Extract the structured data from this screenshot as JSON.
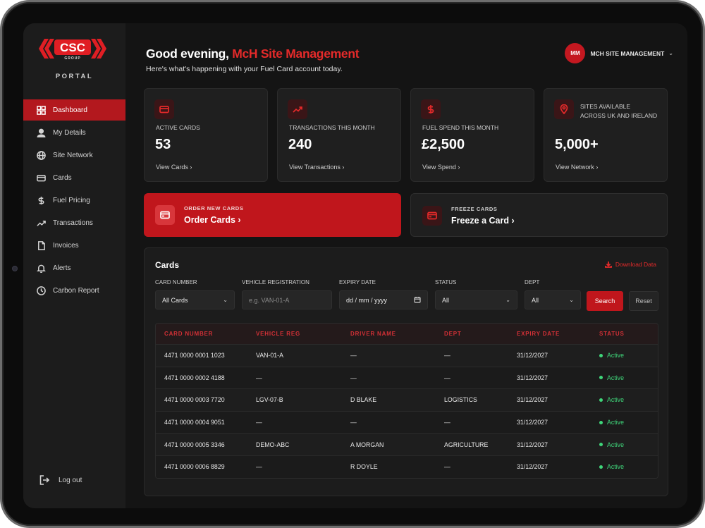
{
  "brand": {
    "logo_text": "CSC",
    "logo_sub": "GROUP",
    "portal": "PORTAL",
    "accent": "#c0161c"
  },
  "sidebar": {
    "items": [
      {
        "label": "Dashboard",
        "icon": "grid-icon",
        "active": true
      },
      {
        "label": "My Details",
        "icon": "user-icon"
      },
      {
        "label": "Site Network",
        "icon": "globe-icon"
      },
      {
        "label": "Cards",
        "icon": "card-icon"
      },
      {
        "label": "Fuel Pricing",
        "icon": "dollar-icon"
      },
      {
        "label": "Transactions",
        "icon": "trend-icon"
      },
      {
        "label": "Invoices",
        "icon": "document-icon"
      },
      {
        "label": "Alerts",
        "icon": "bell-icon"
      },
      {
        "label": "Carbon Report",
        "icon": "clock-icon"
      }
    ],
    "logout": "Log out"
  },
  "header": {
    "greeting_prefix": "Good evening, ",
    "greeting_name": "McH Site Management",
    "subtitle": "Here's what's happening with your Fuel Card account today.",
    "user_initials": "MM",
    "user_name": "MCH SITE MANAGEMENT"
  },
  "stats": [
    {
      "label": "ACTIVE CARDS",
      "value": "53",
      "link": "View Cards ›"
    },
    {
      "label": "TRANSACTIONS THIS MONTH",
      "value": "240",
      "link": "View Transactions ›"
    },
    {
      "label": "FUEL SPEND THIS MONTH",
      "value": "£2,500",
      "link": "View Spend ›"
    },
    {
      "label_line1": "SITES AVAILABLE",
      "label_line2": "ACROSS UK AND IRELAND",
      "value": "5,000+",
      "link": "View Network ›"
    }
  ],
  "actions": {
    "order": {
      "label": "ORDER NEW CARDS",
      "title": "Order Cards ›"
    },
    "freeze": {
      "label": "FREEZE CARDS",
      "title": "Freeze a Card ›"
    }
  },
  "cards_panel": {
    "title": "Cards",
    "download": "Download Data",
    "filters": {
      "card_number": {
        "label": "CARD NUMBER",
        "value": "All Cards"
      },
      "vehicle_reg": {
        "label": "VEHICLE REGISTRATION",
        "placeholder": "e.g. VAN-01-A"
      },
      "expiry": {
        "label": "EXPIRY DATE",
        "placeholder": "dd / mm / yyyy"
      },
      "status": {
        "label": "STATUS",
        "value": "All"
      },
      "dept": {
        "label": "DEPT",
        "value": "All"
      },
      "search": "Search",
      "reset": "Reset"
    },
    "columns": [
      "CARD NUMBER",
      "VEHICLE REG",
      "DRIVER NAME",
      "DEPT",
      "EXPIRY DATE",
      "STATUS"
    ],
    "rows": [
      [
        "4471 0000 0001 1023",
        "VAN-01-A",
        "—",
        "—",
        "31/12/2027",
        "Active"
      ],
      [
        "4471 0000 0002 4188",
        "—",
        "—",
        "—",
        "31/12/2027",
        "Active"
      ],
      [
        "4471 0000 0003 7720",
        "LGV-07-B",
        "D BLAKE",
        "LOGISTICS",
        "31/12/2027",
        "Active"
      ],
      [
        "4471 0000 0004 9051",
        "—",
        "—",
        "—",
        "31/12/2027",
        "Active"
      ],
      [
        "4471 0000 0005 3346",
        "DEMO-ABC",
        "A MORGAN",
        "AGRICULTURE",
        "31/12/2027",
        "Active"
      ],
      [
        "4471 0000 0006 8829",
        "—",
        "R DOYLE",
        "—",
        "31/12/2027",
        "Active"
      ]
    ]
  }
}
